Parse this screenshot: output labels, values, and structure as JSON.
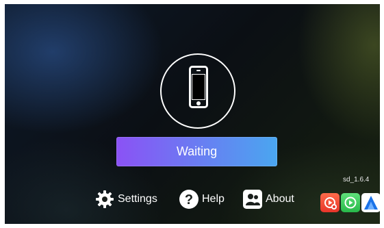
{
  "main": {
    "status_button_label": "Waiting",
    "version": "sd_1.6.4"
  },
  "nav": {
    "items": [
      {
        "label": "Settings",
        "icon": "gear-icon"
      },
      {
        "label": "Help",
        "icon": "help-icon"
      },
      {
        "label": "About",
        "icon": "about-icon"
      }
    ]
  },
  "apps": [
    {
      "icon": "carplay-red-icon",
      "color": "#e8352a"
    },
    {
      "icon": "carplay-green-icon",
      "color": "#28b94a"
    },
    {
      "icon": "android-auto-icon",
      "color": "#1a73e8"
    }
  ],
  "colors": {
    "button_gradient_start": "#8b52f5",
    "button_gradient_end": "#4aa6f0",
    "text": "#ffffff"
  }
}
